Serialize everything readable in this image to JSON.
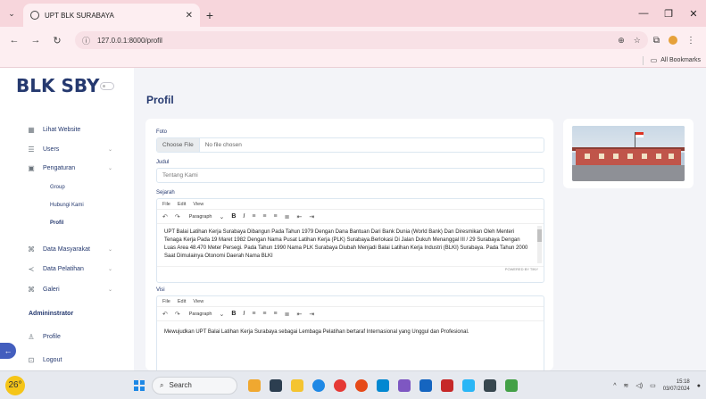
{
  "browser": {
    "tab_title": "UPT BLK SURABAYA",
    "url": "127.0.0.1:8000/profil",
    "bookmarks_label": "All Bookmarks"
  },
  "sidebar": {
    "brand": "BLK SBY",
    "items": [
      {
        "label": "Lihat Website",
        "icon": "grid-icon"
      },
      {
        "label": "Users",
        "icon": "users-icon"
      },
      {
        "label": "Pengaturan",
        "icon": "settings-icon"
      },
      {
        "label": "Data Masyarakat",
        "icon": "people-icon"
      },
      {
        "label": "Data Pelatihan",
        "icon": "training-icon"
      },
      {
        "label": "Galeri",
        "icon": "gallery-icon"
      }
    ],
    "subitems": [
      "Group",
      "Hubungi Kami",
      "Profil"
    ],
    "section": "Admininstrator",
    "profile": "Profile",
    "logout": "Logout"
  },
  "page": {
    "title": "Profil",
    "foto_label": "Foto",
    "file_button": "Choose File",
    "file_status": "No file chosen",
    "judul_label": "Judul",
    "judul_value": "Tentang Kami",
    "sejarah_label": "Sejarah",
    "sejarah_text": "UPT Balai Latihan Kerja Surabaya Dibangun Pada Tahun 1979 Dengan Dana Bantuan Dari Bank Dunia (World Bank) Dan Diresmikan Oleh Menteri Tenaga Kerja Pada 19 Maret 1982 Dengan Nama Pusat Latihan Kerja (PLK) Surabaya.Berlokasi Di Jalan Dukuh Menanggal III / 29 Surabaya Dengan Luas Area 48.470 Meter Persegi. Pada Tahun 1990 Nama PLK Surabaya Diubah Menjadi Balai Latihan Kerja Industri (BLKI) Surabaya. Pada Tahun 2000 Saat Dimulainya Otonomi Daerah Nama BLKI",
    "visi_label": "Visi",
    "visi_text": "Mewujudkan UPT Balai Latihan Kerja Surabaya sebagai Lembaga Pelatihan bertaraf Internasional yang Unggul dan Profesional.",
    "editor_menu": [
      "File",
      "Edit",
      "View"
    ],
    "format_label": "Paragraph",
    "powered_by": "POWERED BY TINY"
  },
  "taskbar": {
    "weather": "26°",
    "search": "Search",
    "time": "15:18",
    "date": "03/07/2024"
  }
}
